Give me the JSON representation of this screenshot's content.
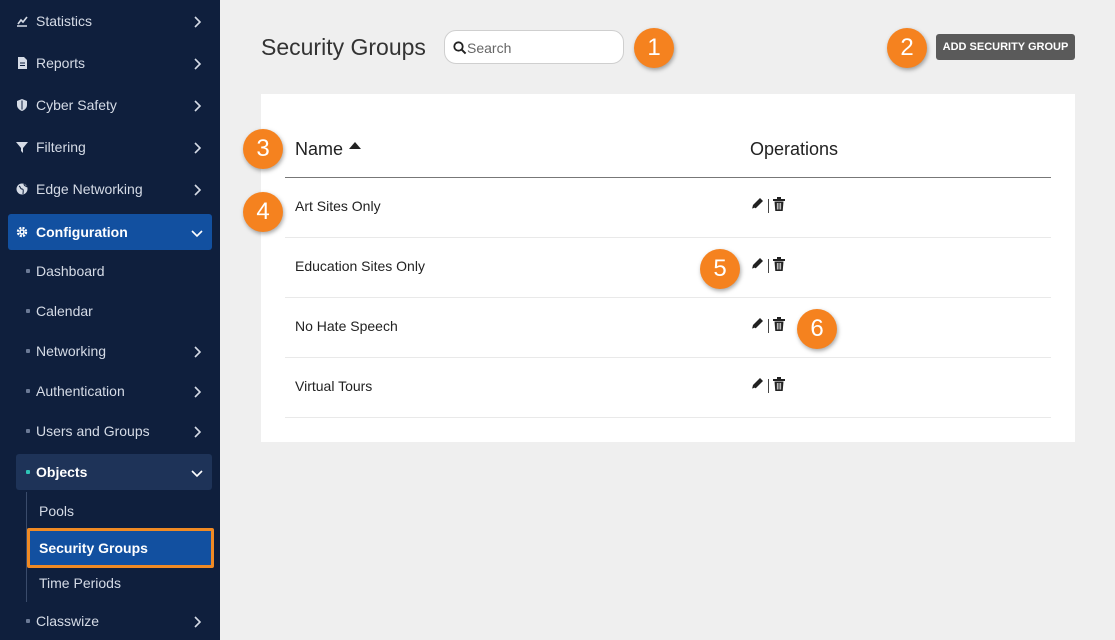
{
  "sidebar": {
    "items": [
      {
        "label": "Statistics",
        "icon": "chart-icon"
      },
      {
        "label": "Reports",
        "icon": "document-icon"
      },
      {
        "label": "Cyber Safety",
        "icon": "shield-icon"
      },
      {
        "label": "Filtering",
        "icon": "filter-icon"
      },
      {
        "label": "Edge Networking",
        "icon": "globe-icon"
      },
      {
        "label": "Configuration",
        "icon": "gear-icon"
      }
    ],
    "config_children": [
      {
        "label": "Dashboard"
      },
      {
        "label": "Calendar"
      },
      {
        "label": "Networking"
      },
      {
        "label": "Authentication"
      },
      {
        "label": "Users and Groups"
      },
      {
        "label": "Objects"
      }
    ],
    "objects_children": [
      {
        "label": "Pools"
      },
      {
        "label": "Security Groups"
      },
      {
        "label": "Time Periods"
      }
    ],
    "after": {
      "label": "Classwize"
    }
  },
  "header": {
    "title": "Security Groups",
    "search_placeholder": "Search",
    "add_button": "ADD SECURITY GROUP"
  },
  "table": {
    "columns": [
      "Name",
      "Operations"
    ],
    "rows": [
      {
        "name": "Art Sites Only"
      },
      {
        "name": "Education Sites Only"
      },
      {
        "name": "No Hate Speech"
      },
      {
        "name": "Virtual Tours"
      }
    ]
  },
  "callouts": [
    "1",
    "2",
    "3",
    "4",
    "5",
    "6"
  ],
  "colors": {
    "sidebar_bg": "#0f1f3d",
    "active_bg": "#1250a0",
    "callout": "#f5821f",
    "highlight_border": "#f08a24"
  }
}
